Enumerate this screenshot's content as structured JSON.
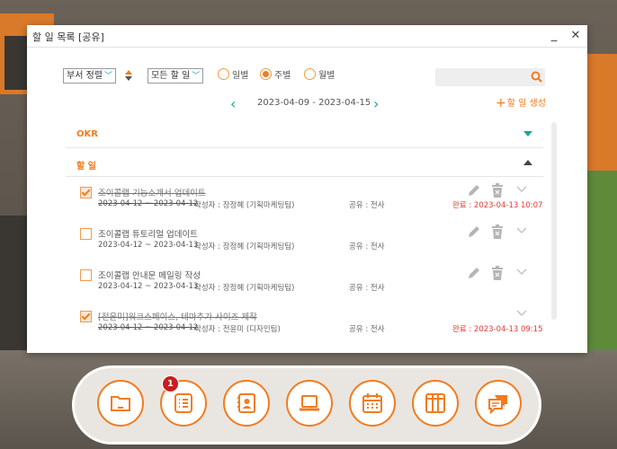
{
  "window": {
    "title": "할 일 목록 [공유]",
    "minimize": "_",
    "close": "✕"
  },
  "toolbar": {
    "dept_sort": "부서 정렬",
    "filter": "모든 할 일",
    "periods": [
      {
        "label": "일별",
        "selected": false
      },
      {
        "label": "주별",
        "selected": true
      },
      {
        "label": "월별",
        "selected": false
      }
    ],
    "search_placeholder": ""
  },
  "date_nav": {
    "range": "2023-04-09 - 2023-04-15",
    "prev": "‹",
    "next": "›"
  },
  "add_label": "할 일 생성",
  "sections": {
    "okr": "OKR",
    "todo": "할 일"
  },
  "tasks": [
    {
      "title": "조이콜랩 기능소개서 업데이트",
      "dates": "2023-04-12 ~ 2023-04-12",
      "author": "작성자 : 장정혜 (기획마케팅팀)",
      "share": "공유 : 전사",
      "done": true,
      "status": "완료 : 2023-04-13 10:07"
    },
    {
      "title": "조이콜랩 튜토리얼 업데이트",
      "dates": "2023-04-12 ~ 2023-04-13",
      "author": "작성자 : 장정혜 (기획마케팅팀)",
      "share": "공유 : 전사",
      "done": false,
      "status": ""
    },
    {
      "title": "조이콜랩 안내문 메일링 작성",
      "dates": "2023-04-12 ~ 2023-04-13",
      "author": "작성자 : 장정혜 (기획마케팅팀)",
      "share": "공유 : 전사",
      "done": false,
      "status": ""
    },
    {
      "title": "[전윤미]워크스페이스, 테마추가 사이즈 제작",
      "dates": "2023-04-12 ~ 2023-04-12",
      "author": "작성자 : 전윤미 (디자인팀)",
      "share": "공유 : 전사",
      "done": true,
      "status": "완료 : 2023-04-13 09:15"
    }
  ],
  "dock": {
    "badge": "1",
    "icons": [
      "folder-icon",
      "todo-list-icon",
      "contacts-icon",
      "laptop-icon",
      "calendar-icon",
      "lockers-icon",
      "chat-icon"
    ]
  },
  "colors": {
    "accent": "#f27c1f",
    "teal": "#1aa3a3",
    "done_red": "#e03c31"
  }
}
